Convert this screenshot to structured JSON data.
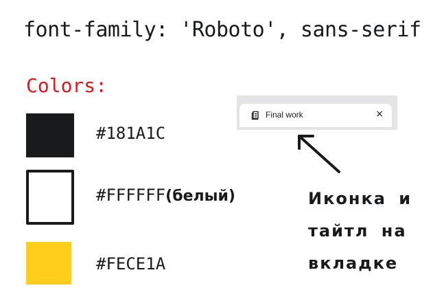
{
  "font_line": "font-family: 'Roboto', sans-serif",
  "colors_heading": "Colors:",
  "swatches": [
    {
      "hex": "#181A1C",
      "label": "#181A1C",
      "suffix": ""
    },
    {
      "hex": "#FFFFFF",
      "label": "#FFFFFF",
      "suffix": "(белый)"
    },
    {
      "hex": "#FECE1A",
      "label": "#FECE1A",
      "suffix": ""
    }
  ],
  "tab": {
    "title": "Final work",
    "close_glyph": "×",
    "icon": "document-icon"
  },
  "caption": "Иконка и\nтайтл на\nвкладке",
  "accent_color": "#e8141a"
}
